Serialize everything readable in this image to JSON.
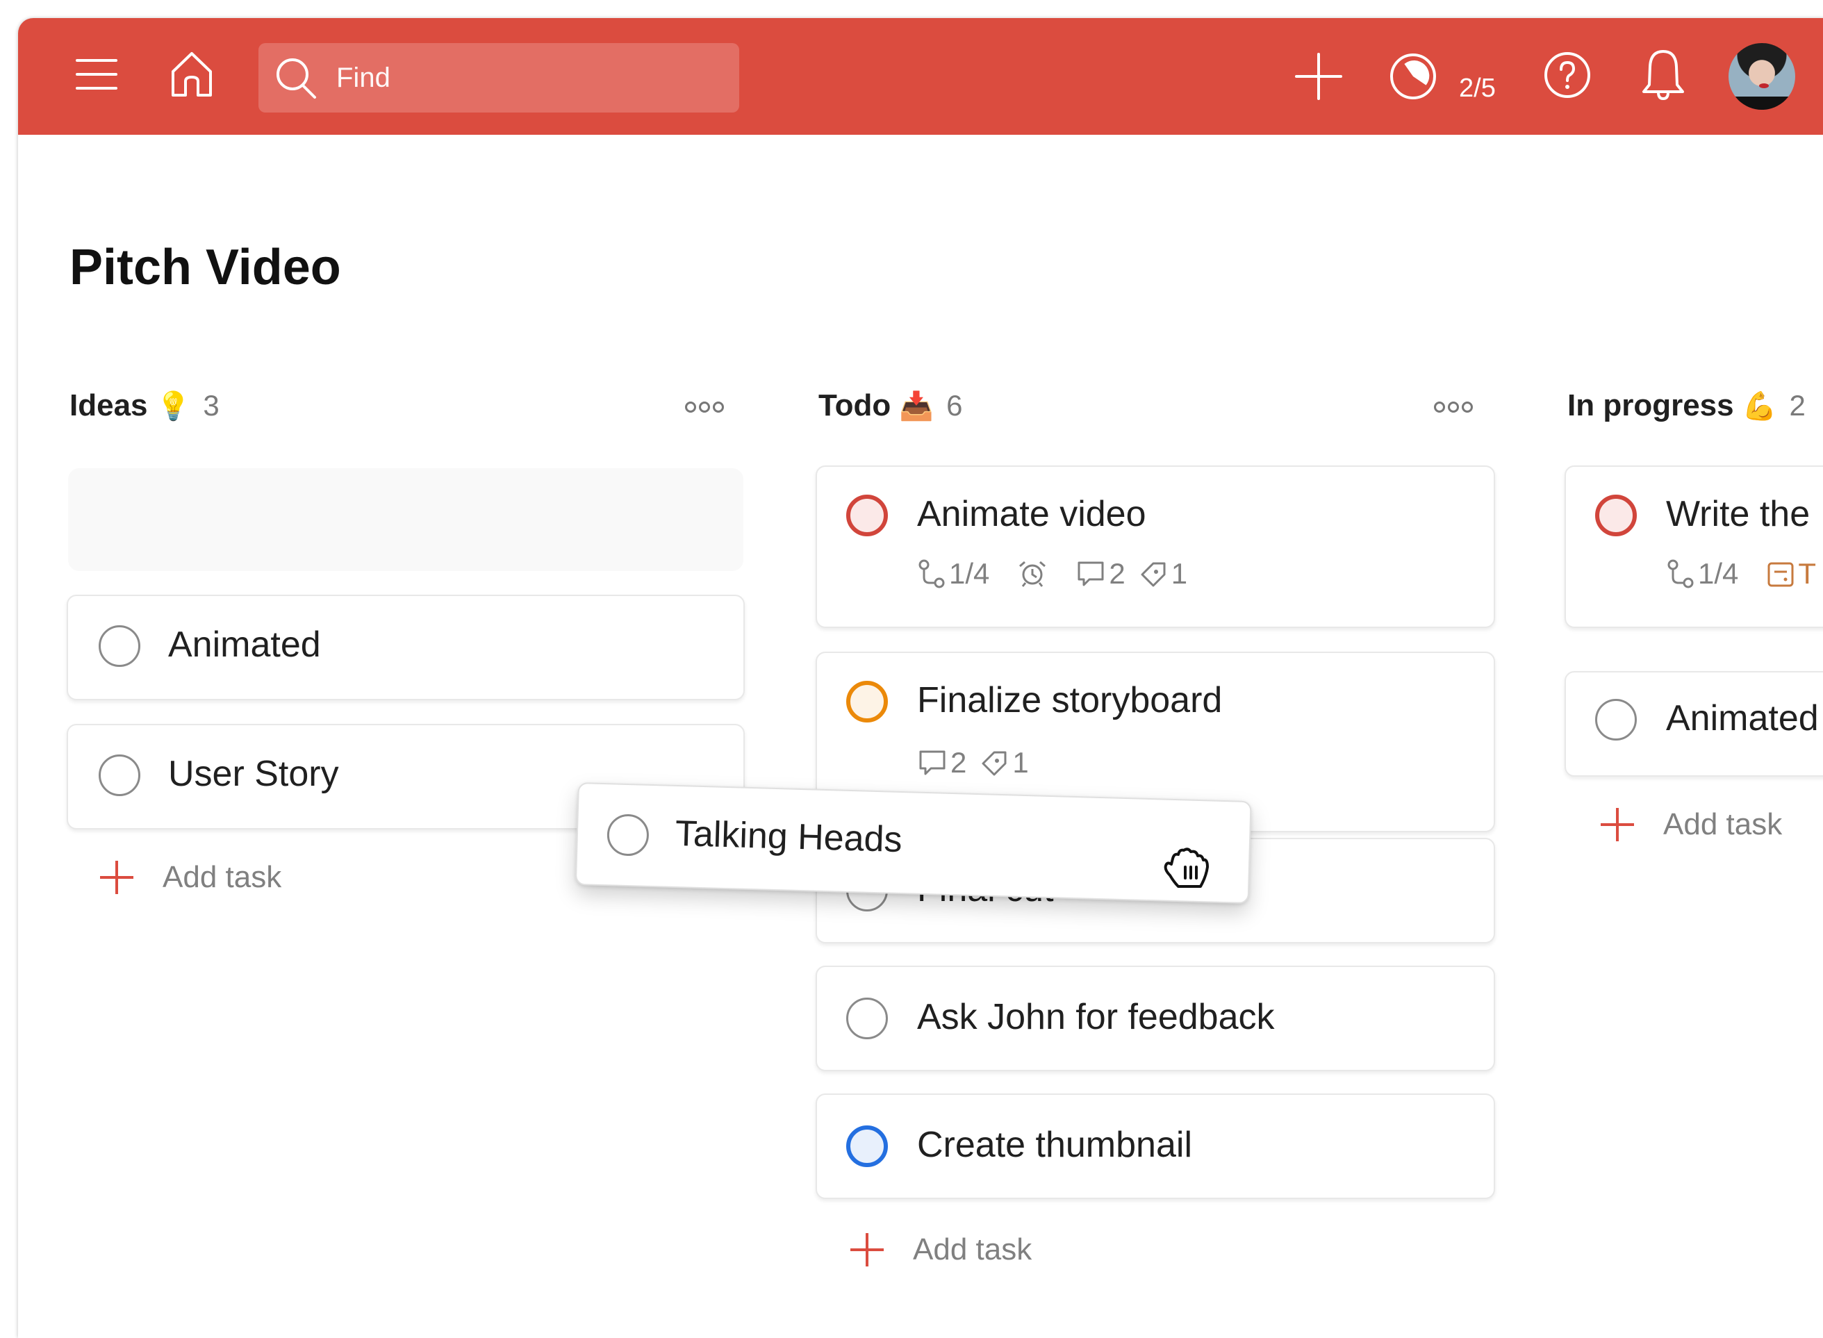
{
  "topbar": {
    "menu_icon": "hamburger-menu-icon",
    "home_icon": "home-icon",
    "search": {
      "placeholder": "Find",
      "value": "",
      "icon": "search-icon"
    },
    "quick_add_icon": "plus-icon",
    "karma": {
      "icon": "productivity-pie-icon",
      "label": "2/5",
      "completed": 2,
      "goal": 5
    },
    "help_icon": "help-circle-icon",
    "notifications_icon": "bell-icon",
    "avatar": "user-avatar"
  },
  "page": {
    "title": "Pitch Video"
  },
  "colors": {
    "brand": "#db4c3f",
    "priority1": "#d1453b",
    "priority2": "#eb8909",
    "priority3": "#246fe0",
    "date": "#c77a3e"
  },
  "columns": [
    {
      "title": "Ideas",
      "emoji": "💡",
      "count": "3",
      "add_task_label": "Add task",
      "tasks": [
        {
          "name": "Animated",
          "priority": 4
        },
        {
          "name": "User Story",
          "priority": 4
        }
      ]
    },
    {
      "title": "Todo",
      "emoji": "📥",
      "count": "6",
      "add_task_label": "Add task",
      "tasks": [
        {
          "name": "Animate video",
          "priority": 1,
          "subtasks": "1/4",
          "reminder": true,
          "comments": "2",
          "labels": "1"
        },
        {
          "name": "Finalize storyboard",
          "priority": 2,
          "comments": "2",
          "labels": "1"
        },
        {
          "name": "Final cut",
          "priority": 4
        },
        {
          "name": "Ask John for feedback",
          "priority": 4
        },
        {
          "name": "Create thumbnail",
          "priority": 3
        }
      ]
    },
    {
      "title": "In progress",
      "emoji": "💪",
      "count": "2",
      "add_task_label": "Add task",
      "tasks": [
        {
          "name": "Write the",
          "priority": 1,
          "subtasks": "1/4",
          "due": "T"
        },
        {
          "name": "Animated",
          "priority": 4
        }
      ]
    }
  ],
  "dragging": {
    "task": {
      "name": "Talking Heads",
      "priority": 4
    },
    "cursor": "grab-hand-cursor"
  }
}
